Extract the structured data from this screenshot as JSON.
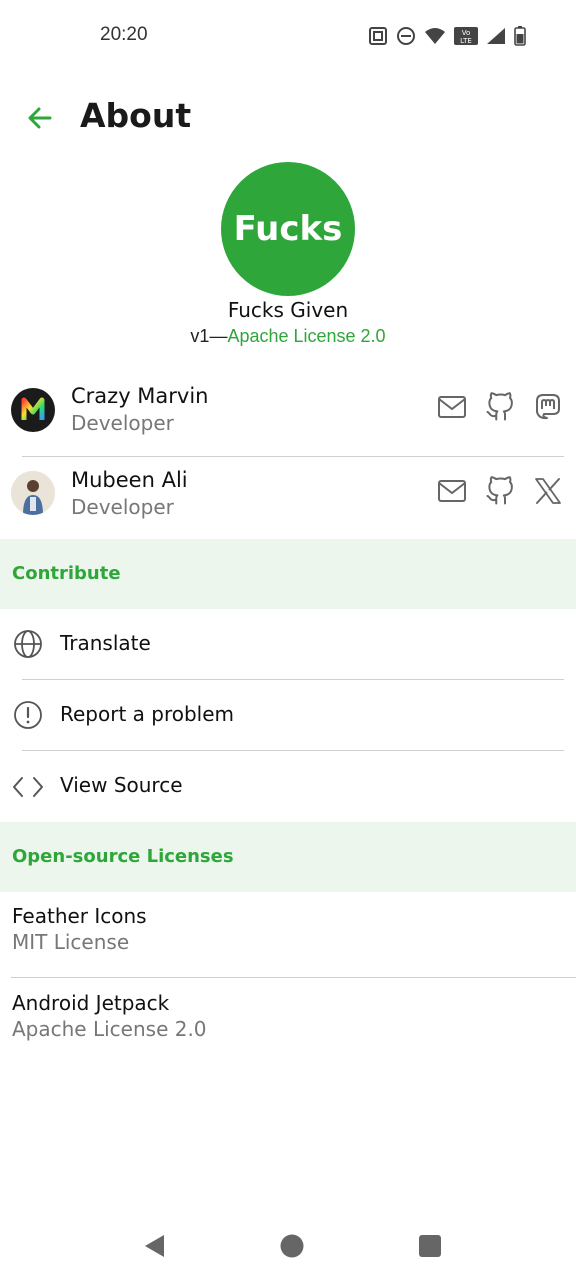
{
  "status_bar": {
    "time": "20:20"
  },
  "header": {
    "title": "About"
  },
  "app": {
    "logo_text": "Fucks",
    "name": "Fucks Given",
    "version": "v1",
    "separator": "—",
    "license": "Apache License 2.0"
  },
  "people": [
    {
      "name": "Crazy Marvin",
      "role": "Developer"
    },
    {
      "name": "Mubeen Ali",
      "role": "Developer"
    }
  ],
  "contribute": {
    "title": "Contribute",
    "items": [
      {
        "label": "Translate",
        "icon": "globe-icon"
      },
      {
        "label": "Report a problem",
        "icon": "alert-circle-icon"
      },
      {
        "label": "View Source",
        "icon": "code-icon"
      }
    ]
  },
  "licenses": {
    "title": "Open-source Licenses",
    "items": [
      {
        "name": "Feather Icons",
        "license": "MIT License"
      },
      {
        "name": "Android Jetpack",
        "license": "Apache License 2.0"
      }
    ]
  },
  "colors": {
    "accent": "#2ea63a",
    "section_bg": "#ecf6ec"
  }
}
